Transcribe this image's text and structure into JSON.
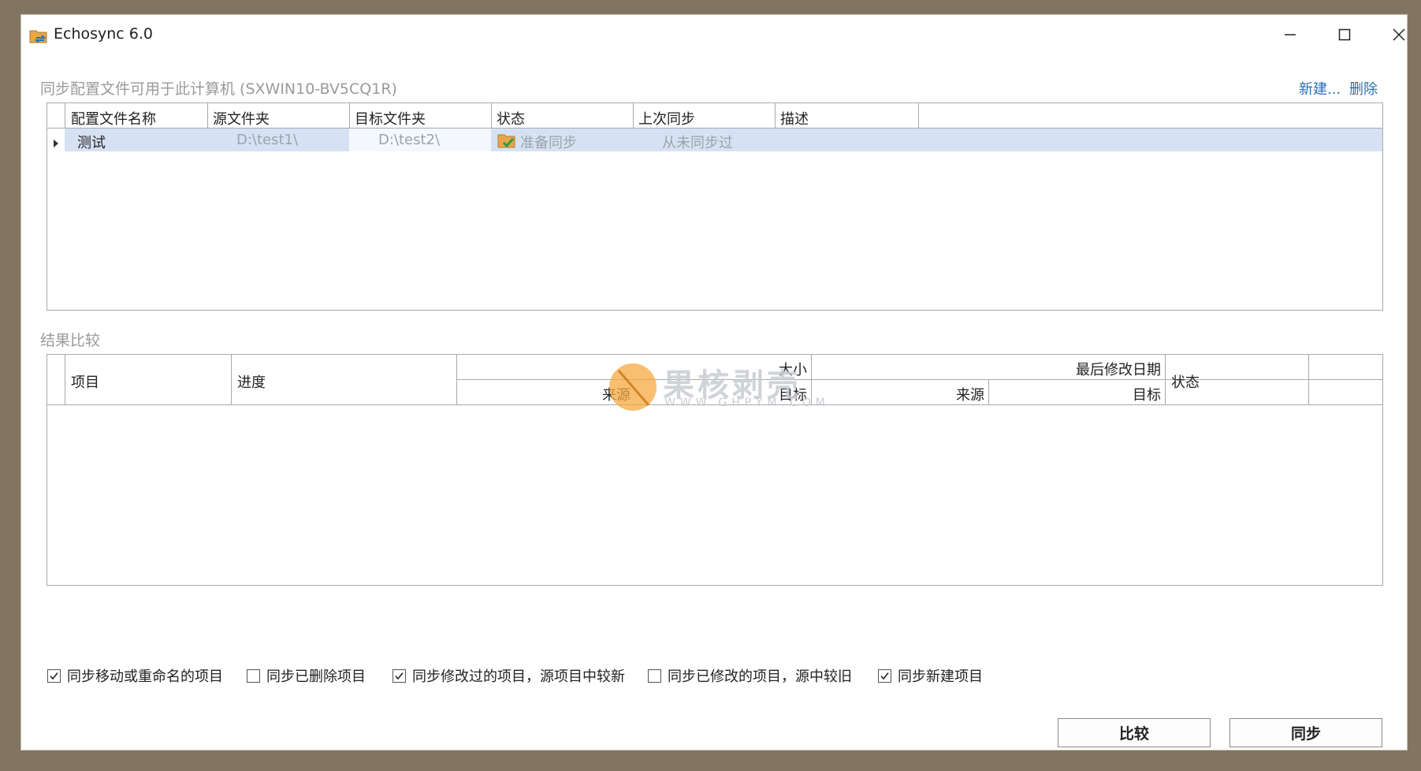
{
  "window": {
    "title": "Echosync 6.0"
  },
  "profiles": {
    "heading": "同步配置文件可用于此计算机 (SXWIN10-BV5CQ1R)",
    "new_link": "新建...",
    "delete_link": "删除",
    "columns": [
      "配置文件名称",
      "源文件夹",
      "目标文件夹",
      "状态",
      "上次同步",
      "描述"
    ],
    "rows": [
      {
        "name": "测试",
        "source": "D:\\test1\\",
        "target": "D:\\test2\\",
        "status": "准备同步",
        "last_sync": "从未同步过",
        "description": ""
      }
    ]
  },
  "results": {
    "heading": "结果比较",
    "columns": {
      "item": "项目",
      "progress": "进度",
      "size": "大小",
      "size_source": "来源",
      "size_target": "目标",
      "modified": "最后修改日期",
      "modified_source": "来源",
      "modified_target": "目标",
      "status": "状态"
    }
  },
  "options": [
    {
      "label": "同步移动或重命名的项目",
      "checked": true
    },
    {
      "label": "同步已删除项目",
      "checked": false
    },
    {
      "label": "同步修改过的项目，源项目中较新",
      "checked": true
    },
    {
      "label": "同步已修改的项目，源中较旧",
      "checked": false
    },
    {
      "label": "同步新建项目",
      "checked": true
    }
  ],
  "buttons": {
    "compare": "比较",
    "sync": "同步"
  },
  "watermark": {
    "name": "果核剥壳",
    "url": "WWW.GHPYM.COM"
  },
  "colors": {
    "link": "#2a6fb3",
    "selection": "#d6e2f3",
    "frame": "#817460"
  }
}
